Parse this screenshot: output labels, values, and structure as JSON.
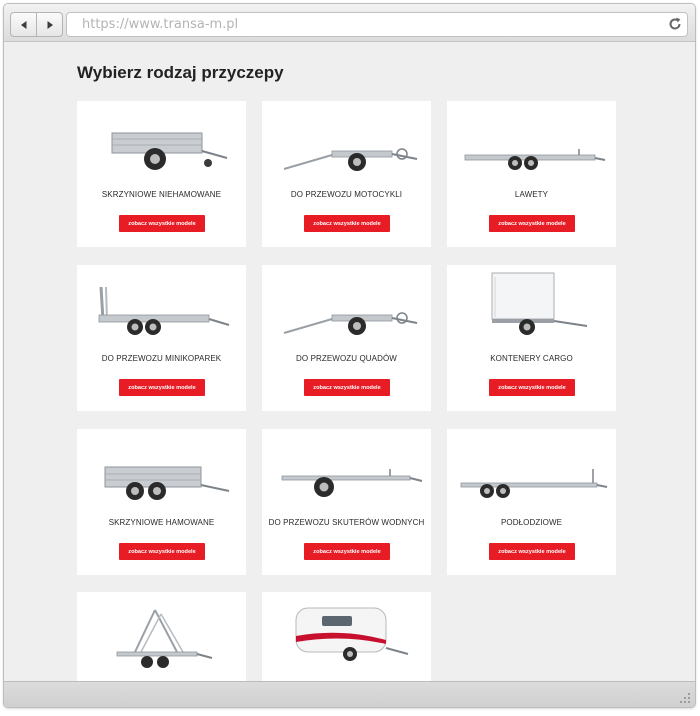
{
  "browser": {
    "url": "https://www.transa-m.pl",
    "back_icon": "back-arrow-icon",
    "forward_icon": "forward-arrow-icon",
    "reload_icon": "reload-icon"
  },
  "page": {
    "heading": "Wybierz rodzaj przyczepy",
    "accent_color": "#e81c24",
    "cards": [
      {
        "title": "SKRZYNIOWE NIEHAMOWANE",
        "button": "zobacz wszystkie modele",
        "image": "box-trailer-unbraked-image"
      },
      {
        "title": "DO PRZEWOZU MOTOCYKLI",
        "button": "zobacz wszystkie modele",
        "image": "motorcycle-trailer-image"
      },
      {
        "title": "LAWETY",
        "button": "zobacz wszystkie modele",
        "image": "car-transporter-image"
      },
      {
        "title": "DO PRZEWOZU MINIKOPAREK",
        "button": "zobacz wszystkie modele",
        "image": "mini-excavator-trailer-image"
      },
      {
        "title": "DO PRZEWOZU QUADÓW",
        "button": "zobacz wszystkie modele",
        "image": "quad-trailer-image"
      },
      {
        "title": "KONTENERY CARGO",
        "button": "zobacz wszystkie modele",
        "image": "cargo-container-trailer-image"
      },
      {
        "title": "SKRZYNIOWE HAMOWANE",
        "button": "zobacz wszystkie modele",
        "image": "box-trailer-braked-image"
      },
      {
        "title": "DO PRZEWOZU SKUTERÓW WODNYCH",
        "button": "zobacz wszystkie modele",
        "image": "jet-ski-trailer-image"
      },
      {
        "title": "PODŁODZIOWE",
        "button": "zobacz wszystkie modele",
        "image": "boat-trailer-image"
      },
      {
        "title": "",
        "button": "",
        "image": "glass-transport-trailer-image"
      },
      {
        "title": "",
        "button": "",
        "image": "caravan-image"
      }
    ]
  }
}
